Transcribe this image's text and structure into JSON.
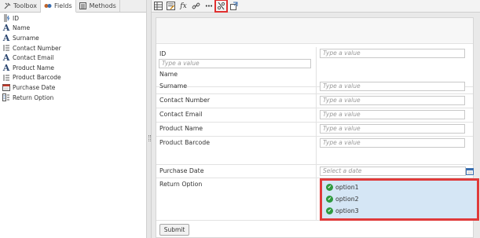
{
  "tabs": [
    {
      "label": "Toolbox",
      "icon": "tools-icon"
    },
    {
      "label": "Fields",
      "icon": "fields-icon"
    },
    {
      "label": "Methods",
      "icon": "methods-icon"
    }
  ],
  "fields": [
    {
      "label": "ID",
      "icon": "autonumber-icon"
    },
    {
      "label": "Name",
      "icon": "text-field-icon"
    },
    {
      "label": "Surname",
      "icon": "text-field-icon"
    },
    {
      "label": "Contact Number",
      "icon": "list-field-icon"
    },
    {
      "label": "Contact Email",
      "icon": "text-field-icon"
    },
    {
      "label": "Product Name",
      "icon": "text-field-icon"
    },
    {
      "label": "Product Barcode",
      "icon": "list-field-icon"
    },
    {
      "label": "Purchase Date",
      "icon": "calendar-icon"
    },
    {
      "label": "Return Option",
      "icon": "choice-field-icon"
    }
  ],
  "toolbar": {
    "buttons": [
      "table-icon",
      "form-edit-icon",
      "formula-icon",
      "link-icon",
      "more-icon",
      "rule-icon",
      "export-icon"
    ],
    "formula_glyph": "fx",
    "more_glyph": "•••"
  },
  "form": {
    "id_label": "ID",
    "id_placeholder": "Type a value",
    "id_placeholder_2": "Type a value",
    "name_label": "Name",
    "surname_label": "Surname",
    "surname_placeholder": "Type a value",
    "contact_number_label": "Contact Number",
    "contact_number_placeholder": "Type a value",
    "contact_email_label": "Contact Email",
    "contact_email_placeholder": "Type a value",
    "product_name_label": "Product Name",
    "product_name_placeholder": "Type a value",
    "product_barcode_label": "Product Barcode",
    "product_barcode_placeholder": "Type a value",
    "purchase_date_label": "Purchase Date",
    "purchase_date_placeholder": "Select a date",
    "return_option_label": "Return Option",
    "options": [
      "option1",
      "option2",
      "option3"
    ],
    "submit_label": "Submit"
  },
  "colors": {
    "highlight": "#e03a3a",
    "option_bg": "#d5e6f5",
    "check": "#2e9a3f"
  }
}
